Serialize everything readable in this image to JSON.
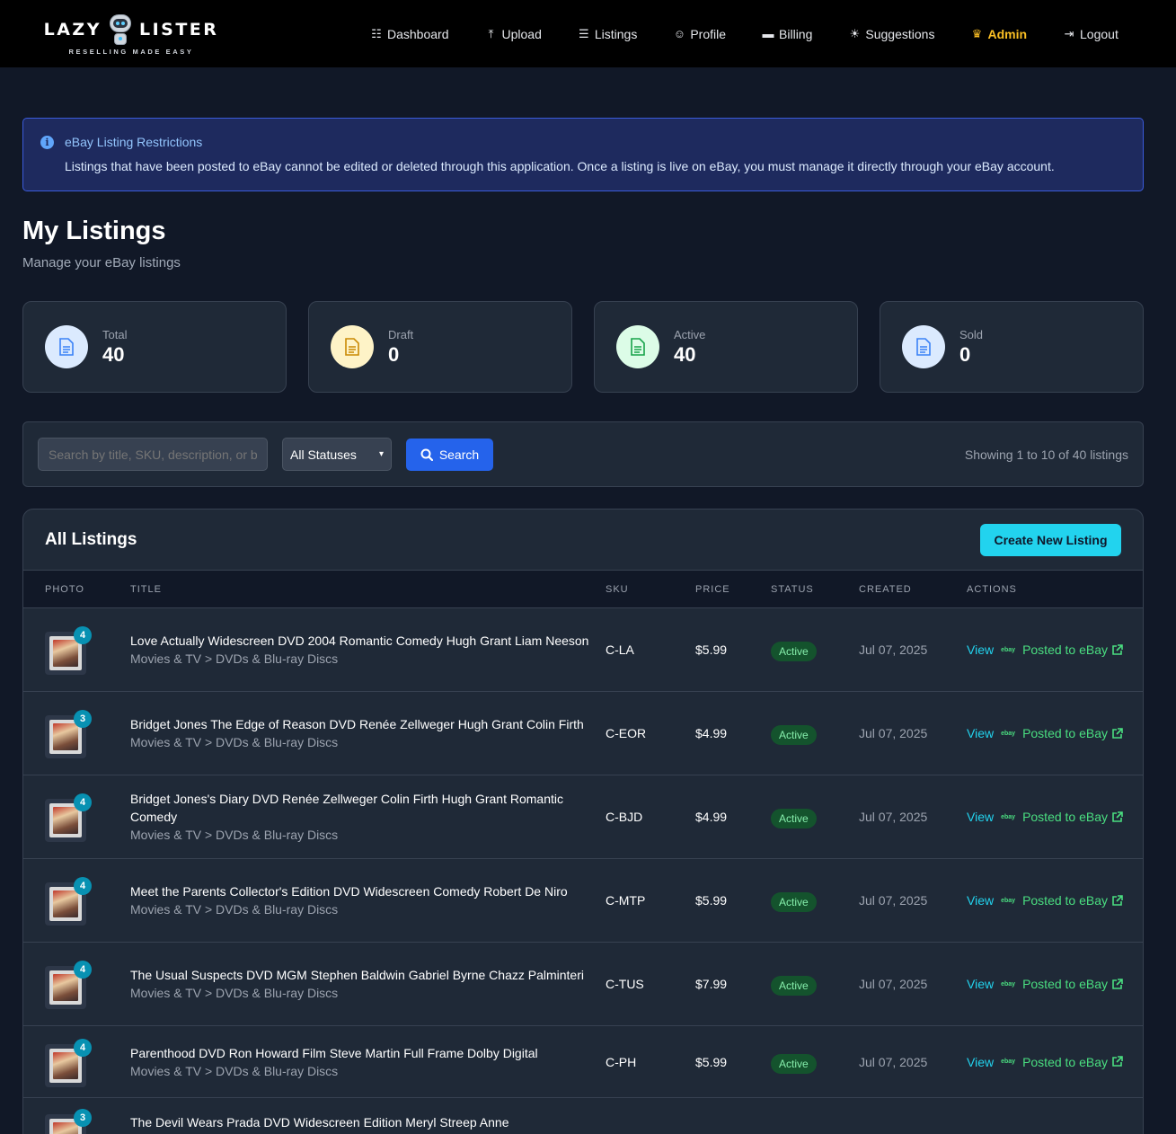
{
  "brand": {
    "left": "LAZY",
    "right": "LISTER",
    "tagline": "RESELLING MADE EASY"
  },
  "nav": [
    {
      "label": "Dashboard",
      "icon": "chart-icon"
    },
    {
      "label": "Upload",
      "icon": "upload-icon"
    },
    {
      "label": "Listings",
      "icon": "list-icon"
    },
    {
      "label": "Profile",
      "icon": "user-icon"
    },
    {
      "label": "Billing",
      "icon": "card-icon"
    },
    {
      "label": "Suggestions",
      "icon": "lightbulb-icon"
    },
    {
      "label": "Admin",
      "icon": "crown-icon"
    },
    {
      "label": "Logout",
      "icon": "logout-icon"
    }
  ],
  "alert": {
    "title": "eBay Listing Restrictions",
    "text": "Listings that have been posted to eBay cannot be edited or deleted through this application. Once a listing is live on eBay, you must manage it directly through your eBay account."
  },
  "page": {
    "title": "My Listings",
    "subtitle": "Manage your eBay listings"
  },
  "stats": [
    {
      "label": "Total",
      "value": "40",
      "color": "#3b82f6",
      "bg": "#dbeafe"
    },
    {
      "label": "Draft",
      "value": "0",
      "color": "#ca8a04",
      "bg": "#fef3c7"
    },
    {
      "label": "Active",
      "value": "40",
      "color": "#16a34a",
      "bg": "#dcfce7"
    },
    {
      "label": "Sold",
      "value": "0",
      "color": "#3b82f6",
      "bg": "#dbeafe"
    }
  ],
  "filter": {
    "search_placeholder": "Search by title, SKU, description, or b",
    "status_value": "All Statuses",
    "search_label": "Search",
    "showing": "Showing 1 to 10 of 40 listings"
  },
  "table": {
    "title": "All Listings",
    "create_label": "Create New Listing",
    "columns": [
      "PHOTO",
      "TITLE",
      "SKU",
      "PRICE",
      "STATUS",
      "CREATED",
      "ACTIONS"
    ],
    "view_label": "View",
    "ebay_mini": "ebay",
    "posted_label": "Posted to eBay",
    "rows": [
      {
        "photos": "4",
        "title": "Love Actually Widescreen DVD 2004 Romantic Comedy Hugh Grant Liam Neeson",
        "category": "Movies & TV > DVDs & Blu-ray Discs",
        "sku": "C-LA",
        "price": "$5.99",
        "status": "Active",
        "created": "Jul 07, 2025"
      },
      {
        "photos": "3",
        "title": "Bridget Jones The Edge of Reason DVD Renée Zellweger Hugh Grant Colin Firth",
        "category": "Movies & TV > DVDs & Blu-ray Discs",
        "sku": "C-EOR",
        "price": "$4.99",
        "status": "Active",
        "created": "Jul 07, 2025"
      },
      {
        "photos": "4",
        "title": "Bridget Jones's Diary DVD Renée Zellweger Colin Firth Hugh Grant Romantic Comedy",
        "category": "Movies & TV > DVDs & Blu-ray Discs",
        "sku": "C-BJD",
        "price": "$4.99",
        "status": "Active",
        "created": "Jul 07, 2025"
      },
      {
        "photos": "4",
        "title": "Meet the Parents Collector's Edition DVD Widescreen Comedy Robert De Niro",
        "category": "Movies & TV > DVDs & Blu-ray Discs",
        "sku": "C-MTP",
        "price": "$5.99",
        "status": "Active",
        "created": "Jul 07, 2025"
      },
      {
        "photos": "4",
        "title": "The Usual Suspects DVD MGM Stephen Baldwin Gabriel Byrne Chazz Palminteri",
        "category": "Movies & TV > DVDs & Blu-ray Discs",
        "sku": "C-TUS",
        "price": "$7.99",
        "status": "Active",
        "created": "Jul 07, 2025"
      },
      {
        "photos": "4",
        "title": "Parenthood DVD Ron Howard Film Steve Martin Full Frame Dolby Digital",
        "category": "Movies & TV > DVDs & Blu-ray Discs",
        "sku": "C-PH",
        "price": "$5.99",
        "status": "Active",
        "created": "Jul 07, 2025"
      },
      {
        "photos": "3",
        "title": "The Devil Wears Prada DVD Widescreen Edition Meryl Streep Anne",
        "category": "",
        "sku": "",
        "price": "",
        "status": "",
        "created": ""
      }
    ]
  }
}
